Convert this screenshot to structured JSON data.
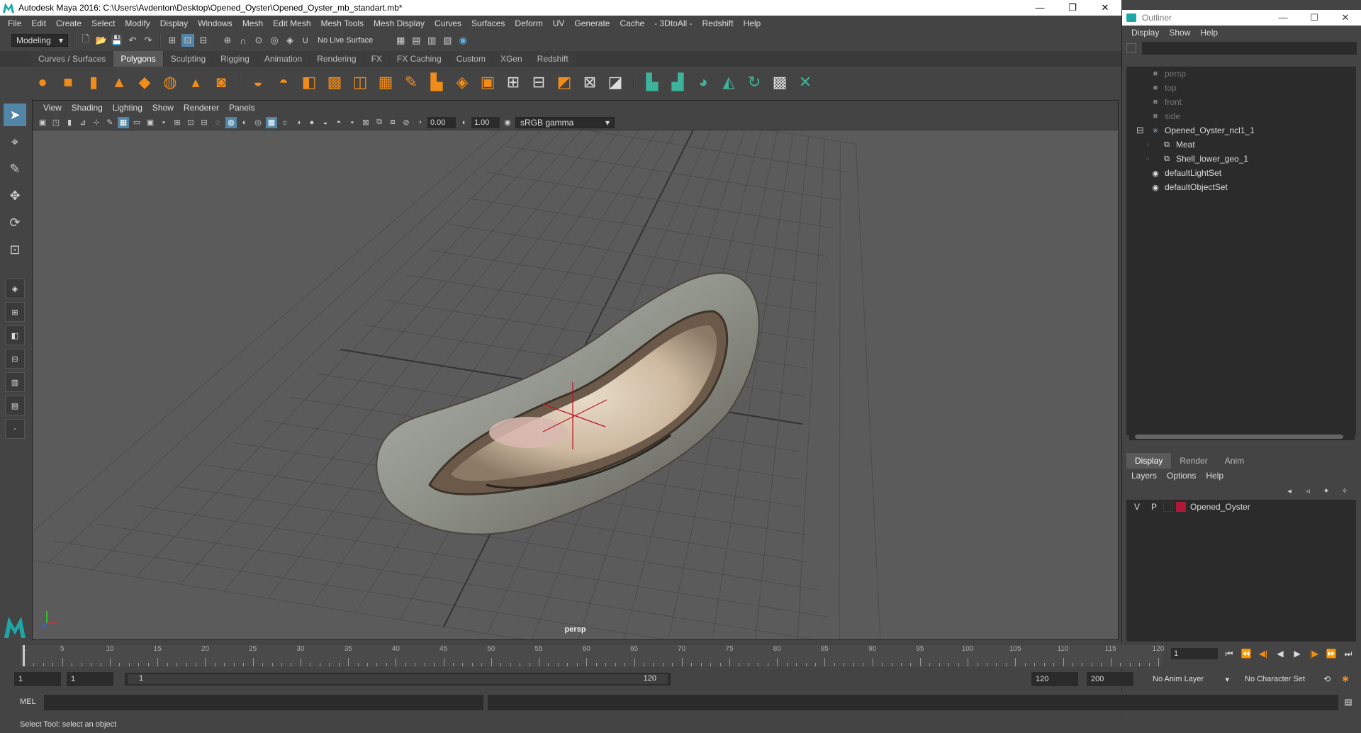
{
  "window": {
    "title": "Autodesk Maya 2016: C:\\Users\\Avdenton\\Desktop\\Opened_Oyster\\Opened_Oyster_mb_standart.mb*",
    "controls": [
      "—",
      "❐",
      "✕"
    ]
  },
  "menubar": [
    "File",
    "Edit",
    "Create",
    "Select",
    "Modify",
    "Display",
    "Windows",
    "Mesh",
    "Edit Mesh",
    "Mesh Tools",
    "Mesh Display",
    "Curves",
    "Surfaces",
    "Deform",
    "UV",
    "Generate",
    "Cache",
    "- 3DtoAll -",
    "Redshift",
    "Help"
  ],
  "statusline": {
    "mode": "Modeling",
    "live_surface": "No Live Surface"
  },
  "shelf": {
    "tabs": [
      "Curves / Surfaces",
      "Polygons",
      "Sculpting",
      "Rigging",
      "Animation",
      "Rendering",
      "FX",
      "FX Caching",
      "Custom",
      "XGen",
      "Redshift"
    ],
    "active_tab": "Polygons"
  },
  "viewport": {
    "menu": [
      "View",
      "Shading",
      "Lighting",
      "Show",
      "Renderer",
      "Panels"
    ],
    "exposure": "0.00",
    "gamma": "1.00",
    "color_space": "sRGB gamma",
    "camera_label": "persp"
  },
  "outliner": {
    "title": "Outliner",
    "window_controls": [
      "—",
      "☐",
      "✕"
    ],
    "menu": [
      "Display",
      "Show",
      "Help"
    ],
    "items": [
      {
        "label": "persp",
        "icon": "camera-icon",
        "depth": 0,
        "dim": true
      },
      {
        "label": "top",
        "icon": "camera-icon",
        "depth": 0,
        "dim": true
      },
      {
        "label": "front",
        "icon": "camera-icon",
        "depth": 0,
        "dim": true
      },
      {
        "label": "side",
        "icon": "camera-icon",
        "depth": 0,
        "dim": true
      },
      {
        "label": "Opened_Oyster_ncl1_1",
        "icon": "group-icon",
        "depth": 0,
        "dim": false,
        "expanded": true
      },
      {
        "label": "Meat",
        "icon": "mesh-icon",
        "depth": 1,
        "dim": false
      },
      {
        "label": "Shell_lower_geo_1",
        "icon": "mesh-icon",
        "depth": 1,
        "dim": false
      },
      {
        "label": "defaultLightSet",
        "icon": "set-icon",
        "depth": 0,
        "dim": false
      },
      {
        "label": "defaultObjectSet",
        "icon": "set-icon",
        "depth": 0,
        "dim": false
      }
    ]
  },
  "layer_editor": {
    "tabs": [
      "Display",
      "Render",
      "Anim"
    ],
    "active_tab": "Display",
    "menu": [
      "Layers",
      "Options",
      "Help"
    ],
    "layers": [
      {
        "visible": "V",
        "playback": "P",
        "name": "Opened_Oyster",
        "color": "#b0183a"
      }
    ]
  },
  "timeline": {
    "ticks": [
      1,
      5,
      10,
      15,
      20,
      25,
      30,
      35,
      40,
      45,
      50,
      55,
      60,
      65,
      70,
      75,
      80,
      85,
      90,
      95,
      100,
      105,
      110,
      115,
      120
    ],
    "current_frame": "1"
  },
  "range": {
    "start": "1",
    "playback_start": "1",
    "slider_start": "1",
    "slider_end": "120",
    "playback_end": "120",
    "end": "200",
    "anim_layer": "No Anim Layer",
    "character_set": "No Character Set"
  },
  "command_line": {
    "label": "MEL"
  },
  "status": {
    "help_text": "Select Tool: select an object"
  }
}
